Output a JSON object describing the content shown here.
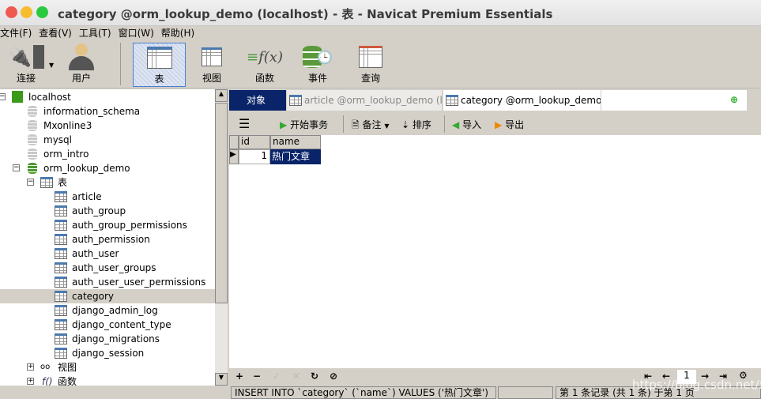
{
  "window": {
    "title": "category @orm_lookup_demo (localhost) - 表 - Navicat Premium Essentials"
  },
  "menu": [
    "文件(F)",
    "查看(V)",
    "工具(T)",
    "窗口(W)",
    "帮助(H)"
  ],
  "toolbar": [
    {
      "label": "连接",
      "icon": "connection-plug-icon"
    },
    {
      "label": "用户",
      "icon": "user-icon"
    },
    {
      "label": "表",
      "icon": "table-icon",
      "selected": true
    },
    {
      "label": "视图",
      "icon": "view-glasses-icon"
    },
    {
      "label": "函数",
      "icon": "function-icon"
    },
    {
      "label": "事件",
      "icon": "event-clock-icon"
    },
    {
      "label": "查询",
      "icon": "query-icon"
    }
  ],
  "tree": {
    "connection": "localhost",
    "databases": [
      "information_schema",
      "Mxonline3",
      "mysql",
      "orm_intro",
      "orm_lookup_demo"
    ],
    "tables_label": "表",
    "tables": [
      "article",
      "auth_group",
      "auth_group_permissions",
      "auth_permission",
      "auth_user",
      "auth_user_groups",
      "auth_user_user_permissions",
      "category",
      "django_admin_log",
      "django_content_type",
      "django_migrations",
      "django_session"
    ],
    "selected_table": "category",
    "views_label": "视图",
    "functions_label": "函数"
  },
  "tabs": {
    "objects": "对象",
    "tab1": "article @orm_lookup_demo (l...",
    "tab2": "category @orm_lookup_demo ..."
  },
  "subtoolbar": {
    "begin_tx": "开始事务",
    "note": "备注",
    "sort": "排序",
    "import": "导入",
    "export": "导出"
  },
  "grid": {
    "columns": [
      "id",
      "name"
    ],
    "rows": [
      [
        "1",
        "热门文章"
      ]
    ]
  },
  "pager": {
    "page": "1"
  },
  "status": {
    "sql": "INSERT INTO `category` (`name`) VALUES ('热门文章')",
    "records": "第 1 条记录 (共 1 条) 于第 1 页"
  },
  "watermark": "https://blog.csdn.net/xujin",
  "colors": {
    "selection": "#0a246a",
    "tab_active": "#0a246a"
  }
}
